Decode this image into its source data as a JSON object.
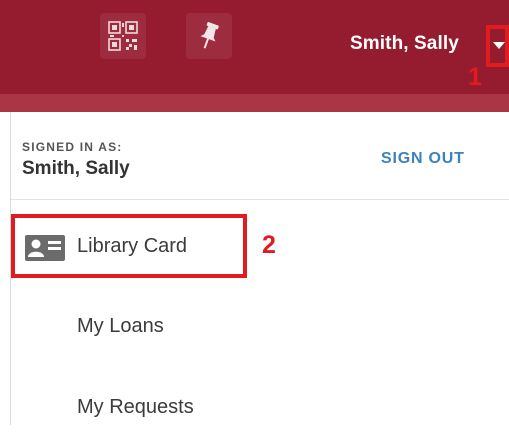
{
  "header": {
    "user_name": "Smith, Sally",
    "qr_icon": "qr-code-icon",
    "pin_icon": "pushpin-icon",
    "dropdown_icon": "caret-down-icon",
    "background_color": "#951b2e"
  },
  "annotations": {
    "step1": "1",
    "step2": "2",
    "color": "#e11c20"
  },
  "account_panel": {
    "signed_in_label": "SIGNED IN AS:",
    "signed_in_name": "Smith, Sally",
    "sign_out_label": "SIGN OUT",
    "menu": [
      {
        "label": "Library Card",
        "icon": "id-card-icon"
      },
      {
        "label": "My Loans"
      },
      {
        "label": "My Requests"
      }
    ]
  }
}
